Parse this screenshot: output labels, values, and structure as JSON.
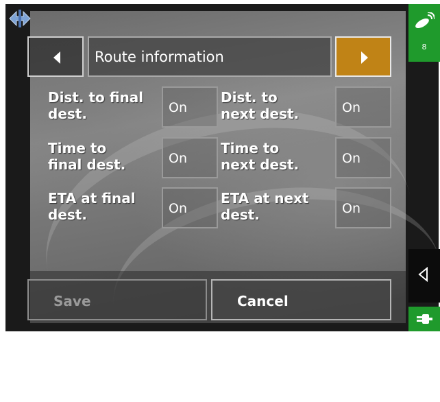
{
  "header": {
    "title": "Route information",
    "prev_icon": "left-arrow-icon",
    "next_icon": "right-arrow-icon"
  },
  "settings": [
    {
      "label_line1": "Dist. to final",
      "label_line2": "dest.",
      "value": "On"
    },
    {
      "label_line1": "Dist. to",
      "label_line2": "next dest.",
      "value": "On"
    },
    {
      "label_line1": "Time to",
      "label_line2": "final dest.",
      "value": "On"
    },
    {
      "label_line1": "Time to",
      "label_line2": "next dest.",
      "value": "On"
    },
    {
      "label_line1": "ETA at final",
      "label_line2": "dest.",
      "value": "On"
    },
    {
      "label_line1": "ETA at next",
      "label_line2": "dest.",
      "value": "On"
    }
  ],
  "footer": {
    "save_label": "Save",
    "cancel_label": "Cancel"
  },
  "side": {
    "satellite_count": "8",
    "gps_icon": "satellite-icon",
    "back_icon": "back-triangle-icon",
    "power_icon": "power-plug-icon"
  },
  "compass_icon": "compass-icon",
  "colors": {
    "accent": "#c08316",
    "status_green": "#1f9a2c",
    "frame": "#1a1a1a"
  }
}
